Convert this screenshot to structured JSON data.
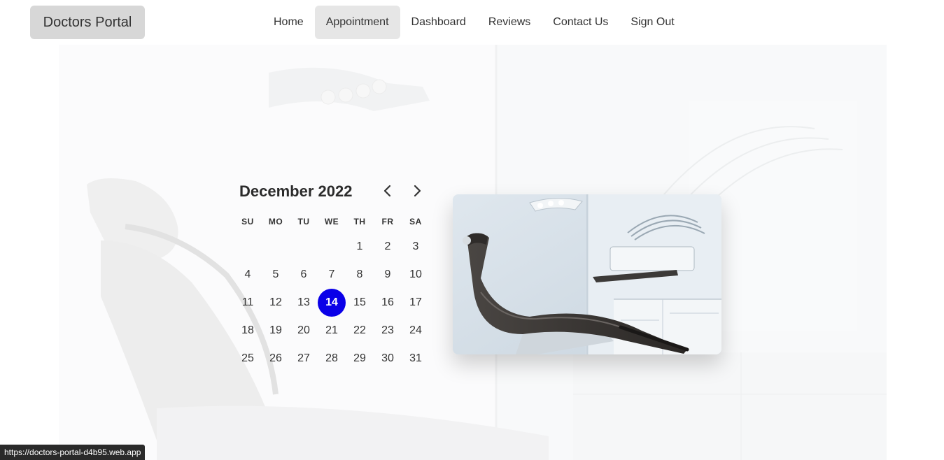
{
  "header": {
    "brand": "Doctors Portal",
    "nav": [
      {
        "label": "Home",
        "active": false
      },
      {
        "label": "Appointment",
        "active": true
      },
      {
        "label": "Dashboard",
        "active": false
      },
      {
        "label": "Reviews",
        "active": false
      },
      {
        "label": "Contact Us",
        "active": false
      },
      {
        "label": "Sign Out",
        "active": false
      }
    ]
  },
  "calendar": {
    "month_title": "December 2022",
    "prev_icon": "chevron-left-icon",
    "next_icon": "chevron-right-icon",
    "weekdays": [
      "SU",
      "MO",
      "TU",
      "WE",
      "TH",
      "FR",
      "SA"
    ],
    "weeks": [
      [
        "",
        "",
        "",
        "",
        "1",
        "2",
        "3"
      ],
      [
        "4",
        "5",
        "6",
        "7",
        "8",
        "9",
        "10"
      ],
      [
        "11",
        "12",
        "13",
        "14",
        "15",
        "16",
        "17"
      ],
      [
        "18",
        "19",
        "20",
        "21",
        "22",
        "23",
        "24"
      ],
      [
        "25",
        "26",
        "27",
        "28",
        "29",
        "30",
        "31"
      ]
    ],
    "selected_day": "14",
    "selected_color": "#0a00e8"
  },
  "status_bar": {
    "url": "https://doctors-portal-d4b95.web.app"
  }
}
